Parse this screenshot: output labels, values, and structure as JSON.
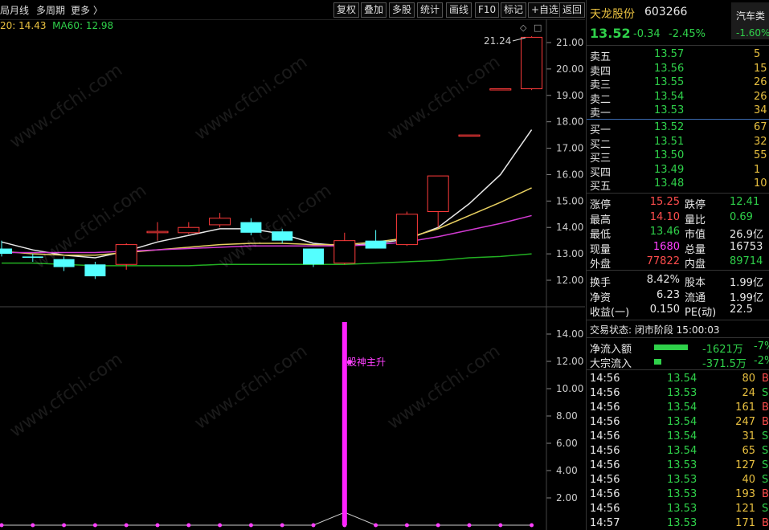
{
  "toolbar": {
    "left_items": [
      "局",
      "月线",
      "多周期",
      "更多 〉"
    ],
    "buttons": [
      "复权",
      "叠加",
      "多股",
      "统计",
      "画线",
      "F10",
      "标记",
      "+自选",
      "返回"
    ]
  },
  "ma": {
    "ma20": "20: 14.43",
    "ma60": "MA60: 12.98"
  },
  "chart": {
    "price_ticks": [
      "21.00",
      "20.00",
      "19.00",
      "18.00",
      "17.00",
      "16.00",
      "15.00",
      "14.00",
      "13.00",
      "12.00"
    ],
    "vol_ticks": [
      "14.00",
      "12.00",
      "10.00",
      "8.00",
      "6.00",
      "4.00",
      "2.00"
    ],
    "high_label": "21.24",
    "signal_label": "股神主升"
  },
  "stock": {
    "name": "天龙股份",
    "code": "603266",
    "sector": "汽车类",
    "sector_pct": "-1.60%",
    "price": "13.52",
    "change": "-0.34",
    "change_pct": "-2.45%"
  },
  "asks": [
    {
      "label": "卖五",
      "price": "13.57",
      "vol": "5"
    },
    {
      "label": "卖四",
      "price": "13.56",
      "vol": "15"
    },
    {
      "label": "卖三",
      "price": "13.55",
      "vol": "26"
    },
    {
      "label": "卖二",
      "price": "13.54",
      "vol": "26"
    },
    {
      "label": "卖一",
      "price": "13.53",
      "vol": "34"
    }
  ],
  "bids": [
    {
      "label": "买一",
      "price": "13.52",
      "vol": "67"
    },
    {
      "label": "买二",
      "price": "13.51",
      "vol": "32"
    },
    {
      "label": "买三",
      "price": "13.50",
      "vol": "55"
    },
    {
      "label": "买四",
      "price": "13.49",
      "vol": "1"
    },
    {
      "label": "买五",
      "price": "13.48",
      "vol": "10"
    }
  ],
  "stats": [
    {
      "l1": "涨停",
      "v1": "15.25",
      "c1": "red",
      "l2": "跌停",
      "v2": "12.41",
      "c2": "green"
    },
    {
      "l1": "最高",
      "v1": "14.10",
      "c1": "red",
      "l2": "量比",
      "v2": "0.69",
      "c2": "green"
    },
    {
      "l1": "最低",
      "v1": "13.46",
      "c1": "green",
      "l2": "市值",
      "v2": "26.9亿",
      "c2": "white"
    },
    {
      "l1": "现量",
      "v1": "1680",
      "c1": "magenta",
      "l2": "总量",
      "v2": "16753",
      "c2": "white"
    },
    {
      "l1": "外盘",
      "v1": "77822",
      "c1": "red",
      "l2": "内盘",
      "v2": "89714",
      "c2": "green"
    }
  ],
  "stats2": [
    {
      "l1": "换手",
      "v1": "8.42%",
      "l2": "股本",
      "v2": "1.99亿"
    },
    {
      "l1": "净资",
      "v1": "6.23",
      "l2": "流通",
      "v2": "1.99亿"
    },
    {
      "l1": "收益(一)",
      "v1": "0.150",
      "l2": "PE(动)",
      "v2": "22.5"
    }
  ],
  "trade_status": "交易状态: 闭市阶段 15:00:03",
  "flows": [
    {
      "label": "净流入额",
      "value": "-1621万",
      "pct": "-7%",
      "bar": 0.8
    },
    {
      "label": "大宗流入",
      "value": "-371.5万",
      "pct": "-2%",
      "bar": 0.18
    }
  ],
  "ticks": [
    {
      "t": "14:56",
      "p": "13.54",
      "v": "80",
      "s": "B"
    },
    {
      "t": "14:56",
      "p": "13.53",
      "v": "24",
      "s": "S"
    },
    {
      "t": "14:56",
      "p": "13.54",
      "v": "161",
      "s": "B"
    },
    {
      "t": "14:56",
      "p": "13.54",
      "v": "247",
      "s": "B"
    },
    {
      "t": "14:56",
      "p": "13.54",
      "v": "31",
      "s": "S"
    },
    {
      "t": "14:56",
      "p": "13.54",
      "v": "65",
      "s": "S"
    },
    {
      "t": "14:56",
      "p": "13.53",
      "v": "127",
      "s": "S"
    },
    {
      "t": "14:56",
      "p": "13.53",
      "v": "40",
      "s": "S"
    },
    {
      "t": "14:56",
      "p": "13.53",
      "v": "193",
      "s": "B"
    },
    {
      "t": "14:56",
      "p": "13.53",
      "v": "121",
      "s": "S"
    },
    {
      "t": "14:57",
      "p": "13.53",
      "v": "171",
      "s": "B"
    }
  ],
  "chart_data": {
    "type": "candlestick",
    "title": "",
    "ylim": [
      11.5,
      21.8
    ],
    "candles": [
      {
        "o": 13.2,
        "c": 13.0,
        "h": 13.5,
        "l": 12.9
      },
      {
        "o": 12.9,
        "c": 12.85,
        "h": 13.0,
        "l": 12.7
      },
      {
        "o": 12.8,
        "c": 12.5,
        "h": 12.9,
        "l": 12.35
      },
      {
        "o": 12.6,
        "c": 12.15,
        "h": 12.7,
        "l": 12.05
      },
      {
        "o": 12.6,
        "c": 13.35,
        "h": 13.4,
        "l": 12.4
      },
      {
        "o": 13.8,
        "c": 13.85,
        "h": 14.2,
        "l": 13.5
      },
      {
        "o": 13.8,
        "c": 14.0,
        "h": 14.2,
        "l": 13.75
      },
      {
        "o": 14.1,
        "c": 14.35,
        "h": 14.55,
        "l": 14.0
      },
      {
        "o": 14.2,
        "c": 13.8,
        "h": 14.35,
        "l": 13.7
      },
      {
        "o": 13.85,
        "c": 13.5,
        "h": 13.95,
        "l": 13.4
      },
      {
        "o": 13.2,
        "c": 12.6,
        "h": 13.2,
        "l": 12.5
      },
      {
        "o": 12.65,
        "c": 13.5,
        "h": 13.8,
        "l": 12.6
      },
      {
        "o": 13.5,
        "c": 13.2,
        "h": 13.9,
        "l": 13.2
      },
      {
        "o": 13.35,
        "c": 14.5,
        "h": 14.6,
        "l": 13.3
      },
      {
        "o": 14.6,
        "c": 15.95,
        "h": 15.95,
        "l": 14.0
      },
      {
        "o": 17.5,
        "c": 17.5,
        "h": 17.5,
        "l": 17.5
      },
      {
        "o": 19.25,
        "c": 19.25,
        "h": 19.25,
        "l": 19.25
      },
      {
        "o": 19.25,
        "c": 21.2,
        "h": 21.24,
        "l": 19.2
      }
    ],
    "ma_white": [
      13.45,
      13.15,
      12.95,
      12.85,
      13.1,
      13.45,
      13.7,
      13.95,
      13.95,
      13.75,
      13.4,
      13.3,
      13.4,
      13.55,
      14.0,
      14.9,
      16.0,
      17.7
    ],
    "ma_yellow": [
      13.1,
      13.0,
      12.95,
      12.95,
      13.05,
      13.15,
      13.25,
      13.35,
      13.4,
      13.4,
      13.35,
      13.35,
      13.45,
      13.6,
      13.95,
      14.45,
      14.95,
      15.5
    ],
    "ma_magenta": [
      13.05,
      13.05,
      13.05,
      13.05,
      13.1,
      13.15,
      13.2,
      13.25,
      13.3,
      13.3,
      13.3,
      13.3,
      13.35,
      13.45,
      13.65,
      13.9,
      14.15,
      14.45
    ],
    "ma_green": [
      12.65,
      12.65,
      12.6,
      12.55,
      12.55,
      12.55,
      12.55,
      12.6,
      12.6,
      12.6,
      12.6,
      12.6,
      12.65,
      12.7,
      12.75,
      12.85,
      12.9,
      13.0
    ],
    "indicator": [
      0,
      0,
      0,
      0,
      0,
      0,
      0,
      0,
      0,
      0,
      0,
      1,
      0,
      0,
      0,
      0,
      0,
      0
    ],
    "indicator_ylim": [
      0,
      15
    ]
  }
}
